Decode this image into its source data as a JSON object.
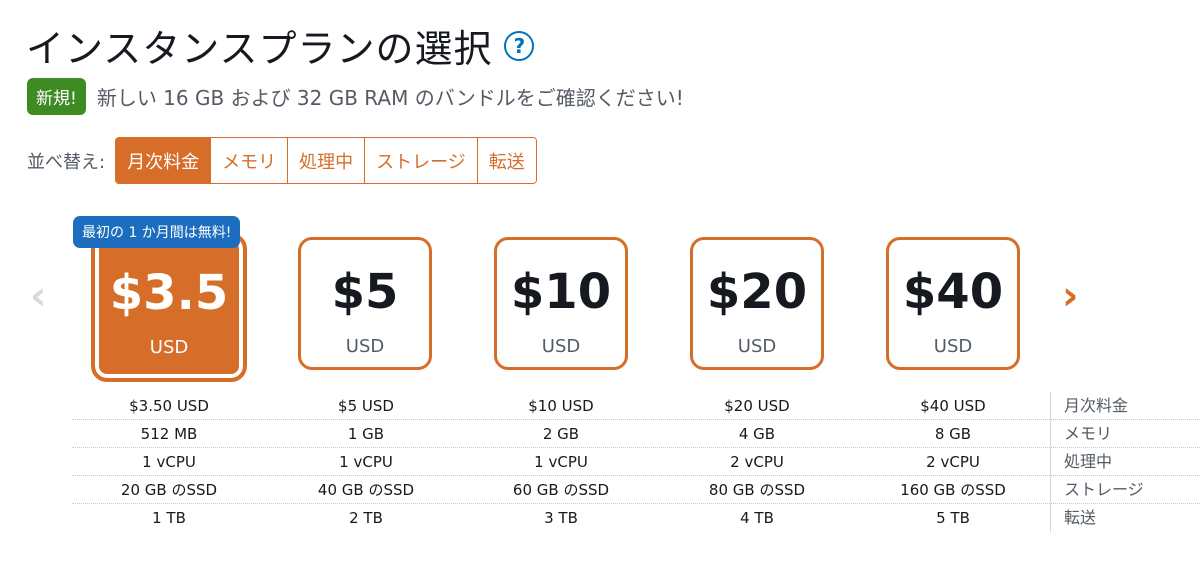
{
  "header": {
    "title": "インスタンスプランの選択",
    "help_icon": "?"
  },
  "notice": {
    "badge": "新規!",
    "text": "新しい 16 GB および 32 GB RAM のバンドルをご確認ください!"
  },
  "sort": {
    "label": "並べ替え:",
    "options": [
      "月次料金",
      "メモリ",
      "処理中",
      "ストレージ",
      "転送"
    ],
    "active": "月次料金"
  },
  "carousel": {
    "prev_icon": "‹",
    "next_icon": "›"
  },
  "promo_badge": "最初の 1 か月間は無料!",
  "plans": [
    {
      "price": "$3.5",
      "currency": "USD",
      "selected": true
    },
    {
      "price": "$5",
      "currency": "USD"
    },
    {
      "price": "$10",
      "currency": "USD"
    },
    {
      "price": "$20",
      "currency": "USD"
    },
    {
      "price": "$40",
      "currency": "USD"
    }
  ],
  "spec_labels": [
    "月次料金",
    "メモリ",
    "処理中",
    "ストレージ",
    "転送"
  ],
  "specs": [
    [
      "$3.50 USD",
      "$5 USD",
      "$10 USD",
      "$20 USD",
      "$40 USD"
    ],
    [
      "512 MB",
      "1 GB",
      "2 GB",
      "4 GB",
      "8 GB"
    ],
    [
      "1 vCPU",
      "1 vCPU",
      "1 vCPU",
      "2 vCPU",
      "2 vCPU"
    ],
    [
      "20 GB のSSD",
      "40 GB のSSD",
      "60 GB のSSD",
      "80 GB のSSD",
      "160 GB のSSD"
    ],
    [
      "1 TB",
      "2 TB",
      "3 TB",
      "4 TB",
      "5 TB"
    ]
  ],
  "colors": {
    "accent": "#d66d28",
    "new_badge": "#3e8a23",
    "promo_badge": "#1d6dbf",
    "help": "#0073bb"
  }
}
